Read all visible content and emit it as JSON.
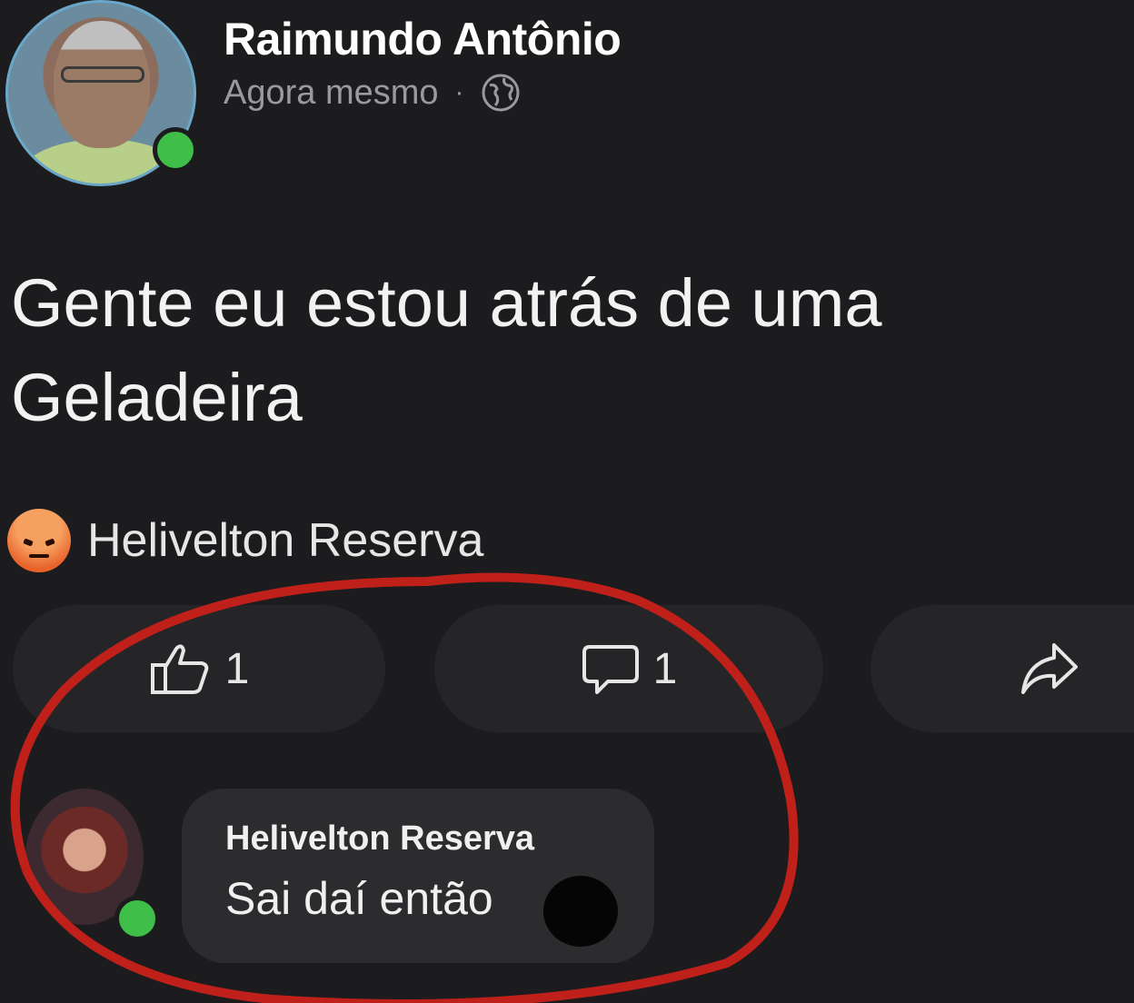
{
  "post": {
    "author": "Raimundo Antônio",
    "timestamp": "Agora mesmo",
    "separator": "·",
    "privacy_icon": "globe-icon",
    "text_line1": "Gente eu estou atrás de uma",
    "text_line2": "Geladeira"
  },
  "reactions": {
    "icon": "angry-reaction-icon",
    "reactor": "Helivelton Reserva"
  },
  "actions": {
    "like_count": "1",
    "comment_count": "1",
    "share_icon": "share-icon"
  },
  "comment": {
    "author": "Helivelton Reserva",
    "text": "Sai daí então"
  },
  "colors": {
    "background": "#1c1c1e",
    "online": "#3fbf4a",
    "highlight_circle": "#c0201a"
  }
}
